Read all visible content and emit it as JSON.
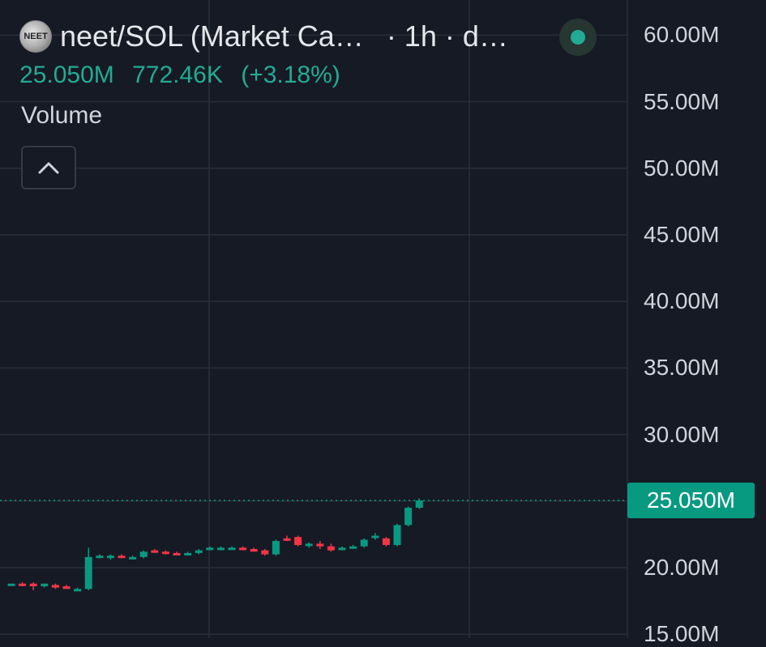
{
  "header": {
    "symbol": "neet/SOL (Market Ca…",
    "interval": "· 1h · d…",
    "logo_text": "NEET",
    "last_value": "25.050M",
    "change_abs": "772.46K",
    "change_pct": "(+3.18%)"
  },
  "volume_label": "Volume",
  "icons": {
    "collapse": "chevron-up-icon",
    "status": "status-dot-icon"
  },
  "colors": {
    "background": "#161a25",
    "up": "#089981",
    "down": "#f23645",
    "text": "#d1d4dc",
    "accent": "#22ab94"
  },
  "chart_data": {
    "type": "candlestick",
    "y_axis": {
      "labels": [
        "60.00M",
        "55.00M",
        "50.00M",
        "45.00M",
        "40.00M",
        "35.00M",
        "30.00M",
        "20.00M",
        "15.00M"
      ],
      "values": [
        60,
        55,
        50,
        45,
        40,
        35,
        30,
        20,
        15
      ],
      "unit": "M",
      "ylim": [
        14.5,
        62
      ]
    },
    "current_price": {
      "label": "25.050M",
      "value": 25.05
    },
    "grid": true,
    "candles": [
      {
        "o": 18.8,
        "h": 18.8,
        "l": 18.8,
        "c": 18.8
      },
      {
        "o": 18.8,
        "h": 18.9,
        "l": 18.6,
        "c": 18.7
      },
      {
        "o": 18.8,
        "h": 18.9,
        "l": 18.3,
        "c": 18.6
      },
      {
        "o": 18.6,
        "h": 18.8,
        "l": 18.5,
        "c": 18.8
      },
      {
        "o": 18.7,
        "h": 18.8,
        "l": 18.4,
        "c": 18.5
      },
      {
        "o": 18.6,
        "h": 18.7,
        "l": 18.4,
        "c": 18.4
      },
      {
        "o": 18.4,
        "h": 18.5,
        "l": 18.3,
        "c": 18.4
      },
      {
        "o": 18.4,
        "h": 21.5,
        "l": 18.3,
        "c": 20.8
      },
      {
        "o": 20.8,
        "h": 21.0,
        "l": 20.7,
        "c": 20.9
      },
      {
        "o": 20.8,
        "h": 21.0,
        "l": 20.6,
        "c": 20.9
      },
      {
        "o": 20.9,
        "h": 21.0,
        "l": 20.7,
        "c": 20.8
      },
      {
        "o": 20.8,
        "h": 20.9,
        "l": 20.7,
        "c": 20.8
      },
      {
        "o": 20.8,
        "h": 21.3,
        "l": 20.7,
        "c": 21.2
      },
      {
        "o": 21.3,
        "h": 21.4,
        "l": 21.1,
        "c": 21.2
      },
      {
        "o": 21.2,
        "h": 21.3,
        "l": 21.0,
        "c": 21.1
      },
      {
        "o": 21.1,
        "h": 21.2,
        "l": 21.0,
        "c": 21.0
      },
      {
        "o": 21.0,
        "h": 21.2,
        "l": 20.9,
        "c": 21.1
      },
      {
        "o": 21.1,
        "h": 21.4,
        "l": 21.0,
        "c": 21.3
      },
      {
        "o": 21.4,
        "h": 21.6,
        "l": 21.3,
        "c": 21.5
      },
      {
        "o": 21.5,
        "h": 21.6,
        "l": 21.3,
        "c": 21.5
      },
      {
        "o": 21.5,
        "h": 21.6,
        "l": 21.4,
        "c": 21.5
      },
      {
        "o": 21.5,
        "h": 21.6,
        "l": 21.3,
        "c": 21.4
      },
      {
        "o": 21.4,
        "h": 21.5,
        "l": 21.2,
        "c": 21.2
      },
      {
        "o": 21.3,
        "h": 21.4,
        "l": 20.9,
        "c": 21.0
      },
      {
        "o": 21.0,
        "h": 22.1,
        "l": 20.9,
        "c": 22.0
      },
      {
        "o": 22.2,
        "h": 22.4,
        "l": 22.0,
        "c": 22.1
      },
      {
        "o": 22.3,
        "h": 22.4,
        "l": 21.6,
        "c": 21.7
      },
      {
        "o": 21.7,
        "h": 21.9,
        "l": 21.5,
        "c": 21.8
      },
      {
        "o": 21.8,
        "h": 22.0,
        "l": 21.4,
        "c": 21.6
      },
      {
        "o": 21.6,
        "h": 21.8,
        "l": 21.2,
        "c": 21.3
      },
      {
        "o": 21.4,
        "h": 21.6,
        "l": 21.3,
        "c": 21.5
      },
      {
        "o": 21.5,
        "h": 21.7,
        "l": 21.4,
        "c": 21.6
      },
      {
        "o": 21.6,
        "h": 22.2,
        "l": 21.5,
        "c": 22.1
      },
      {
        "o": 22.3,
        "h": 22.6,
        "l": 22.1,
        "c": 22.4
      },
      {
        "o": 22.2,
        "h": 22.3,
        "l": 21.6,
        "c": 21.7
      },
      {
        "o": 21.7,
        "h": 23.3,
        "l": 21.6,
        "c": 23.2
      },
      {
        "o": 23.2,
        "h": 24.6,
        "l": 23.1,
        "c": 24.5
      },
      {
        "o": 24.5,
        "h": 25.2,
        "l": 24.4,
        "c": 25.05
      }
    ]
  }
}
